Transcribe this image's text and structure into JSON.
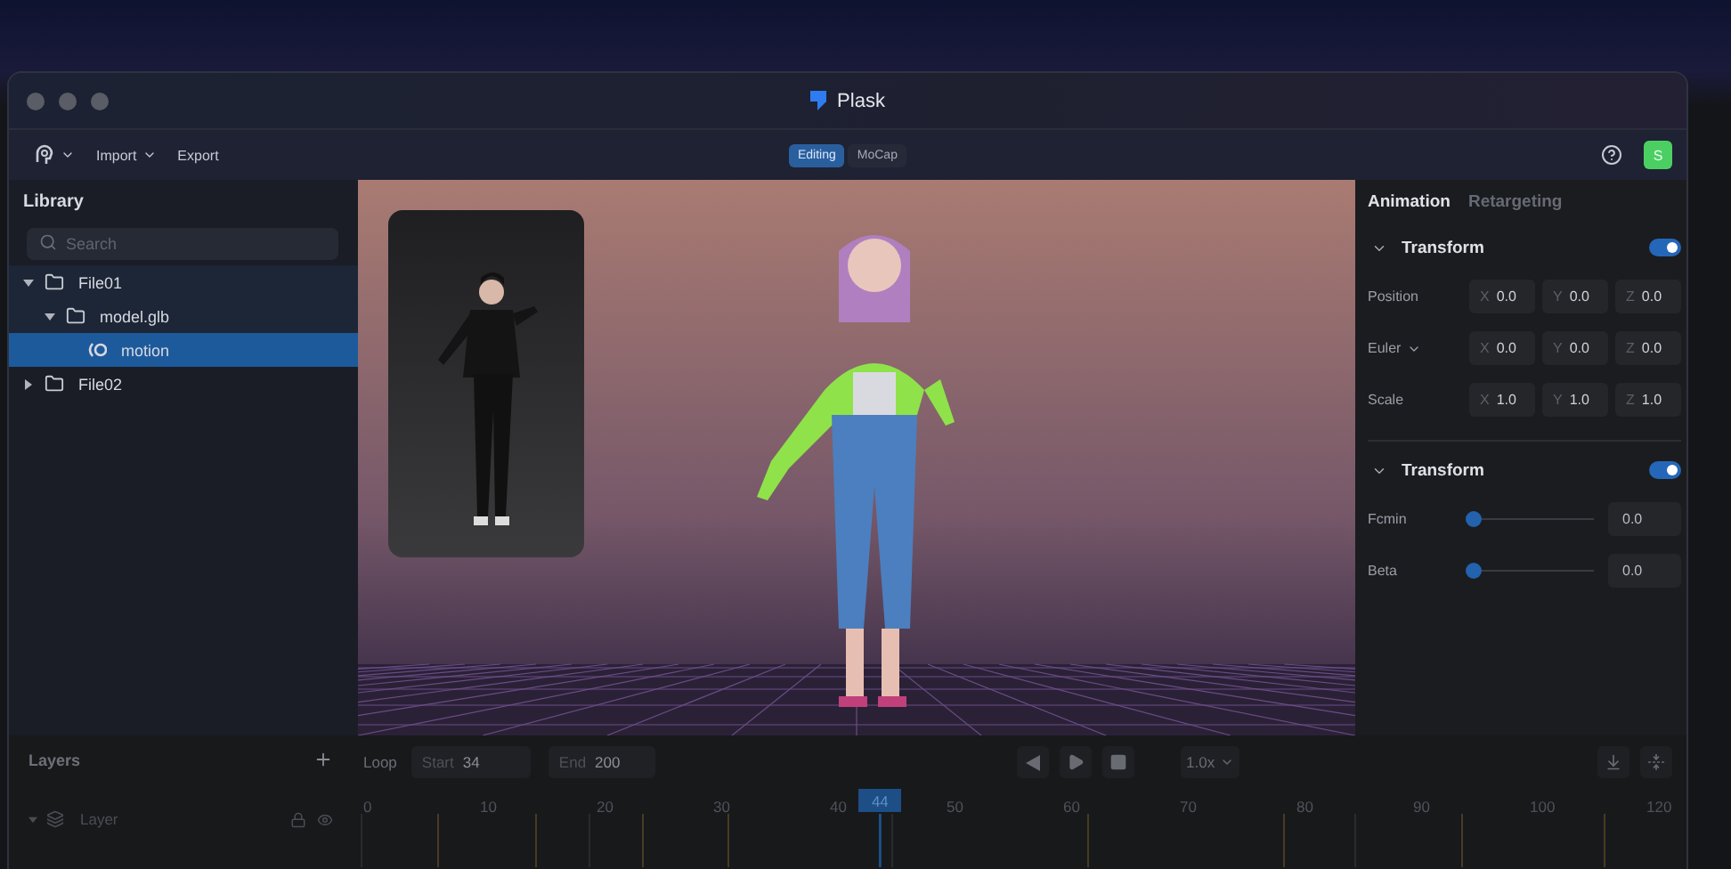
{
  "window": {
    "title": "Plask"
  },
  "toolbar": {
    "menus": [
      {
        "label": "Import",
        "dropdown": true
      },
      {
        "label": "Export",
        "dropdown": false
      }
    ],
    "modes": [
      {
        "label": "Editing",
        "selected": true
      },
      {
        "label": "MoCap",
        "selected": false
      }
    ],
    "avatar": "S"
  },
  "library": {
    "title": "Library",
    "search": {
      "placeholder": "Search"
    },
    "tree": [
      {
        "label": "File01",
        "kind": "folder",
        "expanded": true,
        "selected": false,
        "children": [
          {
            "label": "model.glb",
            "kind": "folder",
            "expanded": true,
            "selected": false,
            "children": [
              {
                "label": "motion",
                "kind": "motion",
                "selected": true
              }
            ]
          }
        ]
      },
      {
        "label": "File02",
        "kind": "folder",
        "expanded": false,
        "selected": false
      }
    ]
  },
  "inspector": {
    "tabs": [
      {
        "label": "Animation",
        "selected": true
      },
      {
        "label": "Retargeting",
        "selected": false
      }
    ],
    "sections": [
      {
        "title": "Transform",
        "expanded": true,
        "on": true,
        "rows": [
          {
            "kind": "vector",
            "label": "Position",
            "dropdown": false,
            "fields": [
              {
                "axis": "X",
                "value": "0.0"
              },
              {
                "axis": "Y",
                "value": "0.0"
              },
              {
                "axis": "Z",
                "value": "0.0"
              }
            ]
          },
          {
            "kind": "vector",
            "label": "Euler",
            "dropdown": true,
            "fields": [
              {
                "axis": "X",
                "value": "0.0"
              },
              {
                "axis": "Y",
                "value": "0.0"
              },
              {
                "axis": "Z",
                "value": "0.0"
              }
            ]
          },
          {
            "kind": "vector",
            "label": "Scale",
            "dropdown": false,
            "fields": [
              {
                "axis": "X",
                "value": "1.0"
              },
              {
                "axis": "Y",
                "value": "1.0"
              },
              {
                "axis": "Z",
                "value": "1.0"
              }
            ]
          }
        ]
      },
      {
        "title": "Transform",
        "expanded": true,
        "on": true,
        "rows": [
          {
            "kind": "slider",
            "label": "Fcmin",
            "level": 0,
            "value": "0.0"
          },
          {
            "kind": "slider",
            "label": "Beta",
            "level": 0,
            "value": "0.0"
          }
        ]
      }
    ]
  },
  "layers": {
    "title": "Layers",
    "tree": [
      {
        "label": "Layer",
        "expanded": true
      }
    ]
  },
  "timeline": {
    "loop": "Loop",
    "start": {
      "label": "Start",
      "value": "34"
    },
    "end": {
      "label": "End",
      "value": "200"
    },
    "speed": "1.0x",
    "ticks": [
      "0",
      "10",
      "20",
      "30",
      "40",
      "50",
      "60",
      "70",
      "80",
      "90",
      "100",
      "120"
    ],
    "playhead": "44"
  }
}
